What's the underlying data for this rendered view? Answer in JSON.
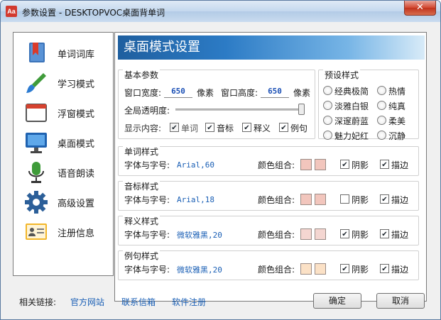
{
  "window": {
    "title": "参数设置 - DESKTOPVOC桌面背单词",
    "app_icon": "Aa",
    "close": "✕"
  },
  "sidebar": {
    "items": [
      {
        "label": "单词词库",
        "icon": "bookmark-book-icon"
      },
      {
        "label": "学习模式",
        "icon": "brush-icon"
      },
      {
        "label": "浮窗模式",
        "icon": "window-icon"
      },
      {
        "label": "桌面模式",
        "icon": "monitor-icon"
      },
      {
        "label": "语音朗读",
        "icon": "microphone-icon"
      },
      {
        "label": "高级设置",
        "icon": "gear-icon"
      },
      {
        "label": "注册信息",
        "icon": "id-card-icon"
      }
    ]
  },
  "main": {
    "header": "桌面模式设置",
    "basic": {
      "title": "基本参数",
      "width_label": "窗口宽度:",
      "width_value": "650",
      "width_unit": "像素",
      "height_label": "窗口高度:",
      "height_value": "650",
      "height_unit": "像素",
      "opacity_label": "全局透明度:",
      "opacity": 1.0,
      "display_label": "显示内容:",
      "display_options": [
        {
          "label": "单词",
          "checked": true,
          "disabled": true
        },
        {
          "label": "音标",
          "checked": true
        },
        {
          "label": "释义",
          "checked": true
        },
        {
          "label": "例句",
          "checked": true
        }
      ]
    },
    "presets": {
      "title": "预设样式",
      "options": [
        "经典极简",
        "热情",
        "淡雅白银",
        "纯真",
        "深邃蔚蓝",
        "柔美",
        "魅力妃红",
        "沉静"
      ]
    },
    "styles": [
      {
        "title": "单词样式",
        "font_label": "字体与字号:",
        "font_value": "Arial,60",
        "color_label": "颜色组合:",
        "colors": [
          "#f2c6bd",
          "#f2c6bd"
        ],
        "shadow_label": "阴影",
        "shadow": true,
        "outline_label": "描边",
        "outline": true
      },
      {
        "title": "音标样式",
        "font_label": "字体与字号:",
        "font_value": "Arial,18",
        "color_label": "颜色组合:",
        "colors": [
          "#f2c6bd",
          "#f2c6bd"
        ],
        "shadow_label": "阴影",
        "shadow": false,
        "outline_label": "描边",
        "outline": true
      },
      {
        "title": "释义样式",
        "font_label": "字体与字号:",
        "font_value": "微软雅黑,20",
        "color_label": "颜色组合:",
        "colors": [
          "#f4d6d1",
          "#f4d6d1"
        ],
        "shadow_label": "阴影",
        "shadow": true,
        "outline_label": "描边",
        "outline": true
      },
      {
        "title": "例句样式",
        "font_label": "字体与字号:",
        "font_value": "微软雅黑,20",
        "color_label": "颜色组合:",
        "colors": [
          "#fbe1c6",
          "#fbe1c6"
        ],
        "shadow_label": "阴影",
        "shadow": true,
        "outline_label": "描边",
        "outline": true
      }
    ]
  },
  "footer": {
    "links_label": "相关链接:",
    "links": [
      "官方网站",
      "联系信箱",
      "软件注册"
    ],
    "ok": "确定",
    "cancel": "取消"
  }
}
